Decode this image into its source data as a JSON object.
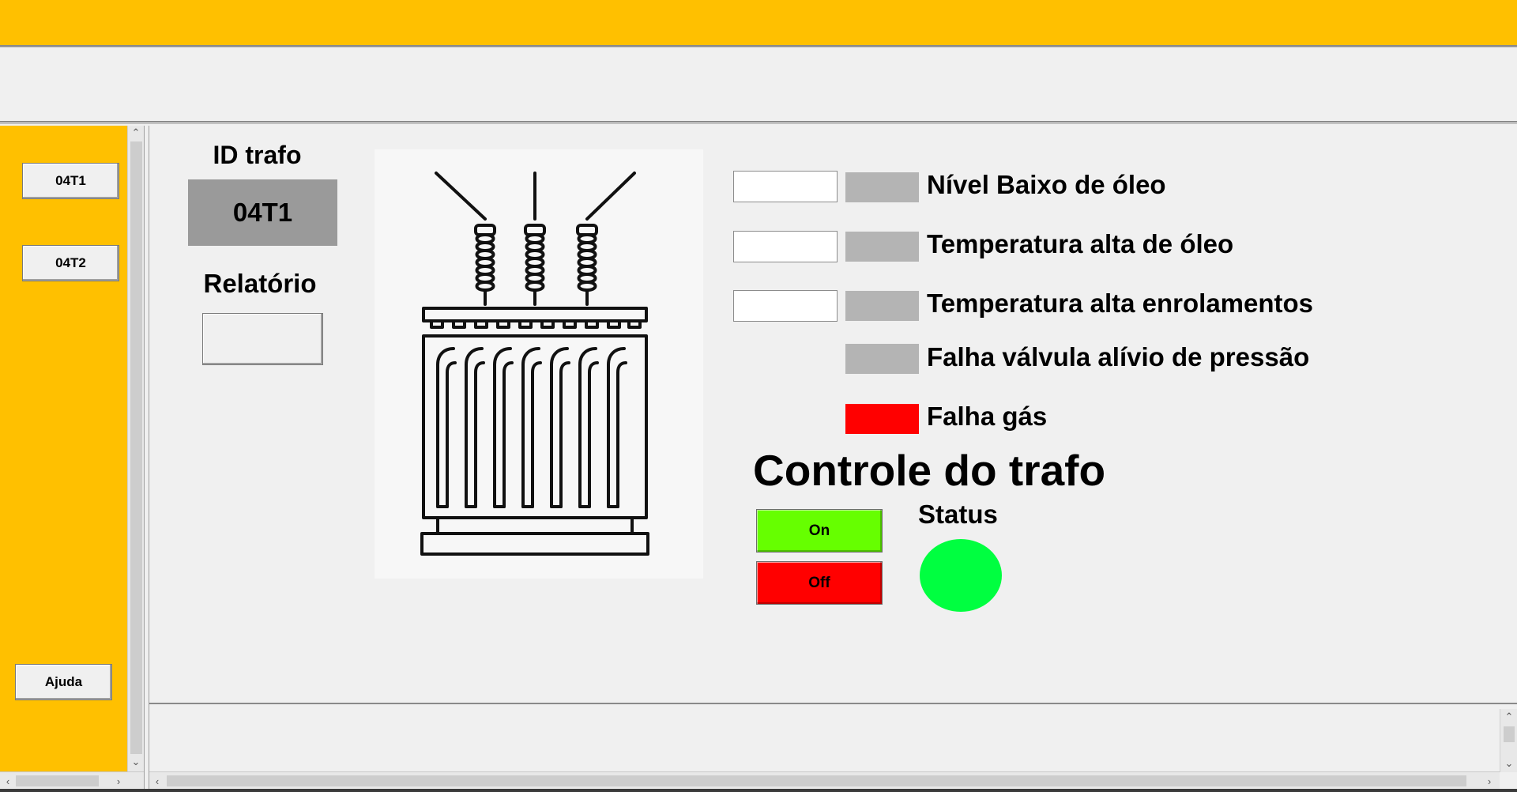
{
  "sidebar": {
    "buttons": [
      "04T1",
      "04T2"
    ],
    "help_label": "Ajuda"
  },
  "panel": {
    "id_label": "ID trafo",
    "id_value": "04T1",
    "report_label": "Relatório"
  },
  "alarms": [
    {
      "label": "Nível Baixo de óleo",
      "led_color": "#b4b4b4",
      "has_input": true
    },
    {
      "label": "Temperatura alta de óleo",
      "led_color": "#b4b4b4",
      "has_input": true
    },
    {
      "label": "Temperatura alta enrolamentos",
      "led_color": "#b4b4b4",
      "has_input": true
    },
    {
      "label": "Falha válvula alívio de pressão",
      "led_color": "#b4b4b4",
      "has_input": false
    },
    {
      "label": "Falha gás",
      "led_color": "#ff0000",
      "has_input": false
    }
  ],
  "control": {
    "title": "Controle do trafo",
    "on_label": "On",
    "off_label": "Off",
    "status_label": "Status",
    "status_color": "#00ff40",
    "on_color": "#66ff00",
    "off_color": "#ff0000"
  },
  "colors": {
    "accent": "#ffc000",
    "led_inactive": "#b4b4b4"
  },
  "icons": {
    "transformer": "transformer-icon"
  }
}
